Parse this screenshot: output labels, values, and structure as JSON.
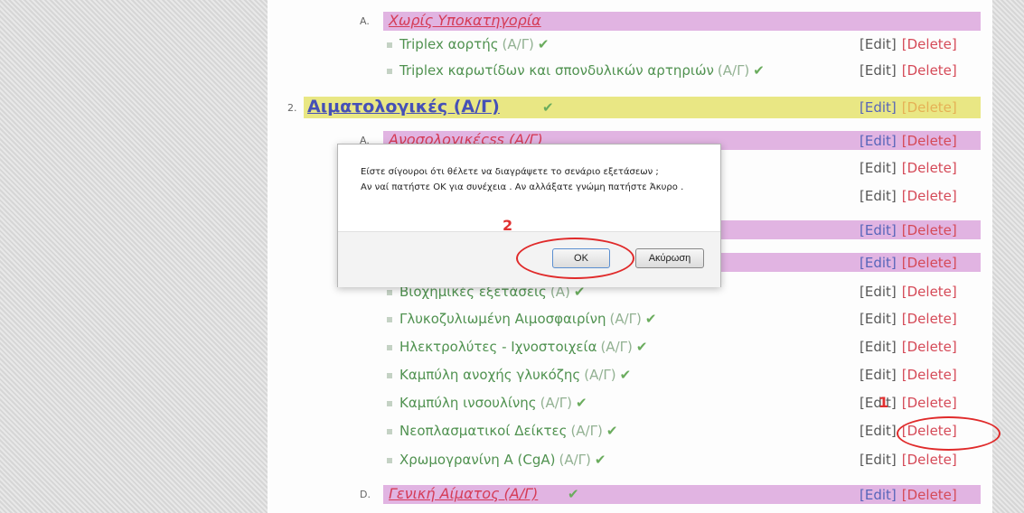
{
  "list": {
    "actions": {
      "edit": "[Edit]",
      "delete": "[Delete]"
    },
    "group_a": {
      "letter": "A.",
      "title": "Χωρίς Υποκατηγορία"
    },
    "items_top": [
      {
        "name": "Triplex αορτής",
        "tag": "(Α/Γ)"
      },
      {
        "name": "Triplex καρωτίδων και σπονδυλικών αρτηριών",
        "tag": "(Α/Γ)"
      }
    ],
    "category_2": {
      "number": "2.",
      "title": "Αιματολογικές (Α/Γ)"
    },
    "group_a2": {
      "letter": "A.",
      "title": "Ανοσολογικέςss (Α/Γ)"
    },
    "items_bottom": [
      {
        "name": "Βιοχημικές εξετάσεις",
        "tag": "(Α)"
      },
      {
        "name": "Γλυκοζυλιωμένη Αιμοσφαιρίνη",
        "tag": "(Α/Γ)"
      },
      {
        "name": "Ηλεκτρολύτες - Ιχνοστοιχεία",
        "tag": "(Α/Γ)"
      },
      {
        "name": "Καμπύλη ανοχής γλυκόζης",
        "tag": "(Α/Γ)"
      },
      {
        "name": "Καμπύλη ινσουλίνης",
        "tag": "(Α/Γ)"
      },
      {
        "name": "Νεοπλασματικοί Δείκτες",
        "tag": "(Α/Γ)"
      },
      {
        "name": "Χρωμογρανίνη Α (CgA)",
        "tag": "(Α/Γ)"
      }
    ],
    "group_d": {
      "letter": "D.",
      "title": "Γενική Αίματος (Α/Γ)"
    }
  },
  "dialog": {
    "line1": "Είστε σίγουροι ότι θέλετε να διαγράψετε το σενάριο εξετάσεων ;",
    "line2": "Αν ναί πατήστε OK για συνέχεια . Αν αλλάξατε γνώμη πατήστε Άκυρο .",
    "ok_label": "OK",
    "cancel_label": "Ακύρωση"
  },
  "annotations": {
    "step1": "1",
    "step2": "2",
    "color": "#e02a2a"
  },
  "icons": {
    "check": "check-icon",
    "bullet": "bullet-icon"
  }
}
